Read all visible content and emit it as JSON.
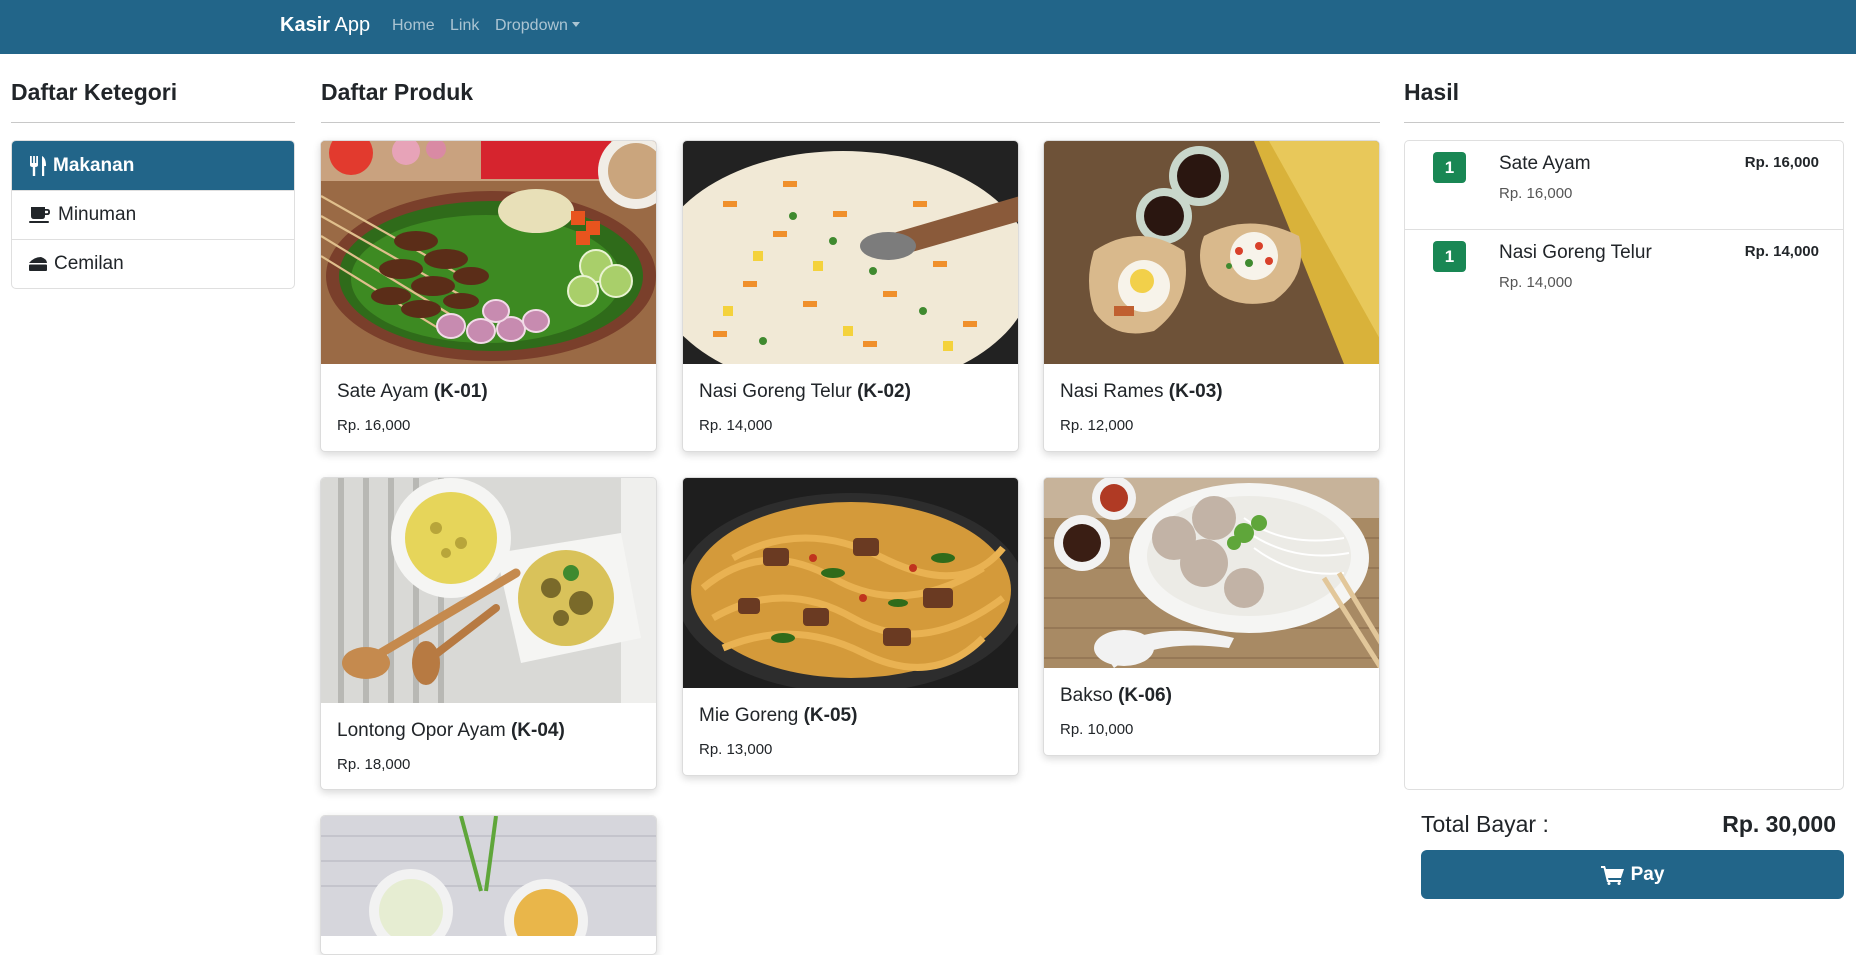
{
  "navbar": {
    "brand_bold": "Kasir",
    "brand_rest": " App",
    "links": [
      "Home",
      "Link",
      "Dropdown"
    ]
  },
  "sections": {
    "categories_title": "Daftar Ketegori",
    "products_title": "Daftar Produk",
    "result_title": "Hasil"
  },
  "categories": [
    {
      "label": "Makanan",
      "icon": "utensils-icon",
      "active": true
    },
    {
      "label": "Minuman",
      "icon": "coffee-icon",
      "active": false
    },
    {
      "label": "Cemilan",
      "icon": "cheese-icon",
      "active": false
    }
  ],
  "products": [
    {
      "name": "Sate Ayam",
      "code": "(K-01)",
      "price": "Rp. 16,000",
      "image": "sate-ayam-photo"
    },
    {
      "name": "Nasi Goreng Telur",
      "code": "(K-02)",
      "price": "Rp. 14,000",
      "image": "nasi-goreng-photo"
    },
    {
      "name": "Nasi Rames",
      "code": "(K-03)",
      "price": "Rp. 12,000",
      "image": "nasi-rames-photo"
    },
    {
      "name": "Lontong Opor Ayam",
      "code": "(K-04)",
      "price": "Rp. 18,000",
      "image": "lontong-opor-photo"
    },
    {
      "name": "Mie Goreng",
      "code": "(K-05)",
      "price": "Rp. 13,000",
      "image": "mie-goreng-photo"
    },
    {
      "name": "Bakso",
      "code": "(K-06)",
      "price": "Rp. 10,000",
      "image": "bakso-photo"
    },
    {
      "name": "",
      "code": "",
      "price": "",
      "image": "partial-photo"
    }
  ],
  "cart": [
    {
      "qty": "1",
      "name": "Sate Ayam",
      "unit_price": "Rp. 16,000",
      "total": "Rp. 16,000"
    },
    {
      "qty": "1",
      "name": "Nasi Goreng Telur",
      "unit_price": "Rp. 14,000",
      "total": "Rp. 14,000"
    }
  ],
  "summary": {
    "total_label": "Total Bayar :",
    "total_value": "Rp. 30,000",
    "pay_label": "Pay"
  },
  "colors": {
    "primary": "#226589",
    "badge": "#198754"
  }
}
